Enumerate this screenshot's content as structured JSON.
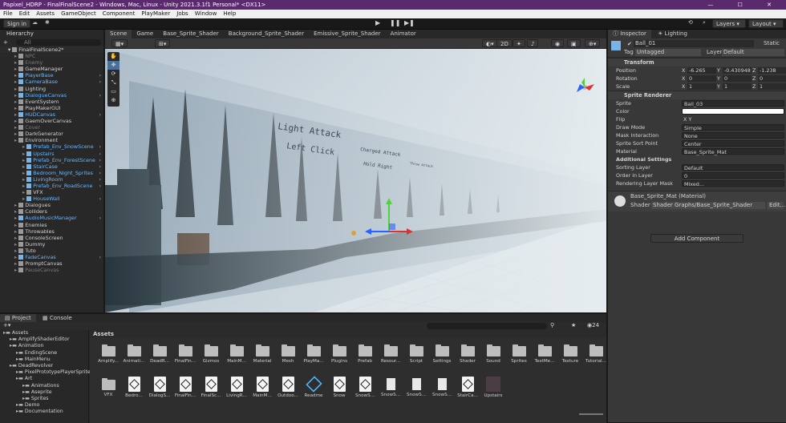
{
  "titlebar": {
    "title": "Papixel_HDRP - FinalFinalScene2 - Windows, Mac, Linux - Unity 2021.3.1f1 Personal* <DX11>",
    "controls": "—  ☐  ✕"
  },
  "menu": [
    "File",
    "Edit",
    "Assets",
    "GameObject",
    "Component",
    "PlayMaker",
    "Jobs",
    "Window",
    "Help"
  ],
  "toolbar": {
    "signin": "Sign in",
    "layers": "Layers",
    "layout": "Layout"
  },
  "hierarchy": {
    "tab": "Hierarchy",
    "add": "+",
    "search": "All",
    "scene": "FinalFinalScene2*",
    "items": [
      {
        "label": "NPC",
        "d": 1,
        "c": "dim"
      },
      {
        "label": "Enemy",
        "d": 1,
        "c": "dim"
      },
      {
        "label": "GameManager",
        "d": 1,
        "c": ""
      },
      {
        "label": "PlayerBase",
        "d": 1,
        "c": "blue"
      },
      {
        "label": "CameraBase",
        "d": 1,
        "c": "blue"
      },
      {
        "label": "Lighting",
        "d": 1,
        "c": ""
      },
      {
        "label": "DialogueCanvas",
        "d": 1,
        "c": "blue"
      },
      {
        "label": "EventSystem",
        "d": 1,
        "c": ""
      },
      {
        "label": "PlayMakerGUI",
        "d": 1,
        "c": ""
      },
      {
        "label": "HUDCanvas",
        "d": 1,
        "c": "blue"
      },
      {
        "label": "GaemOverCanvas",
        "d": 1,
        "c": ""
      },
      {
        "label": "Cover",
        "d": 1,
        "c": "dim"
      },
      {
        "label": "DarkGenerator",
        "d": 1,
        "c": ""
      },
      {
        "label": "Environment",
        "d": 1,
        "c": ""
      },
      {
        "label": "Prefab_Env_SnowScene",
        "d": 2,
        "c": "blue"
      },
      {
        "label": "Upstairs",
        "d": 2,
        "c": "blue"
      },
      {
        "label": "Prefab_Env_ForestScene",
        "d": 2,
        "c": "blue"
      },
      {
        "label": "StairCase",
        "d": 2,
        "c": "blue"
      },
      {
        "label": "Bedroom_Night_Sprites",
        "d": 2,
        "c": "blue"
      },
      {
        "label": "LivingRoom",
        "d": 2,
        "c": "blue"
      },
      {
        "label": "Prefab_Env_RoadScene",
        "d": 2,
        "c": "blue"
      },
      {
        "label": "VFX",
        "d": 2,
        "c": ""
      },
      {
        "label": "HouseWall",
        "d": 2,
        "c": "blue"
      },
      {
        "label": "Dialogues",
        "d": 1,
        "c": ""
      },
      {
        "label": "Colliders",
        "d": 1,
        "c": ""
      },
      {
        "label": "AudioMusicManager",
        "d": 1,
        "c": "blue"
      },
      {
        "label": "Enemies",
        "d": 1,
        "c": ""
      },
      {
        "label": "Throwables",
        "d": 1,
        "c": ""
      },
      {
        "label": "ConsoleScreen",
        "d": 1,
        "c": ""
      },
      {
        "label": "Dummy",
        "d": 1,
        "c": ""
      },
      {
        "label": "Tuto",
        "d": 1,
        "c": ""
      },
      {
        "label": "FadeCanvas",
        "d": 1,
        "c": "blue"
      },
      {
        "label": "PromptCanvas",
        "d": 1,
        "c": ""
      },
      {
        "label": "PauseCanvas",
        "d": 1,
        "c": "dim"
      }
    ]
  },
  "sceneview": {
    "tabs": [
      "Scene",
      "Game",
      "Base_Sprite_Shader",
      "Background_Sprite_Shader",
      "Emissive_Sprite_Shader",
      "Animator"
    ],
    "mode2d": "2D",
    "signs": {
      "light_attack": "Light Attack",
      "left_click": "Left Click",
      "charged": "Charged Attack",
      "hold": "Hold Right",
      "throw": "Throw Attack"
    }
  },
  "inspector": {
    "tabs": [
      "Inspector",
      "Lighting"
    ],
    "object": "Ball_01",
    "static": "Static",
    "tag_label": "Tag",
    "tag": "Untagged",
    "layer_label": "Layer",
    "layer": "Default",
    "transform": {
      "title": "Transform",
      "rows": [
        {
          "label": "Position",
          "x": "-6.265",
          "y": "-0.430948",
          "z": "-1.238"
        },
        {
          "label": "Rotation",
          "x": "0",
          "y": "0",
          "z": "0"
        },
        {
          "label": "Scale",
          "x": "1",
          "y": "1",
          "z": "1"
        }
      ]
    },
    "sprite_renderer": {
      "title": "Sprite Renderer",
      "rows": [
        {
          "label": "Sprite",
          "value": "Ball_03"
        },
        {
          "label": "Color",
          "value": ""
        },
        {
          "label": "Flip",
          "value": "X   Y"
        },
        {
          "label": "Draw Mode",
          "value": "Simple"
        },
        {
          "label": "Mask Interaction",
          "value": "None"
        },
        {
          "label": "Sprite Sort Point",
          "value": "Center"
        },
        {
          "label": "Material",
          "value": "Base_Sprite_Mat"
        }
      ],
      "additional": "Additional Settings",
      "extra": [
        {
          "label": "Sorting Layer",
          "value": "Default"
        },
        {
          "label": "Order in Layer",
          "value": "0"
        },
        {
          "label": "Rendering Layer Mask",
          "value": "Mixed..."
        }
      ]
    },
    "material": {
      "name": "Base_Sprite_Mat (Material)",
      "shader_label": "Shader",
      "shader": "Shader Graphs/Base_Sprite_Shader",
      "edit": "Edit..."
    },
    "add_component": "Add Component"
  },
  "project": {
    "tabs": [
      "Project",
      "Console"
    ],
    "count": "24",
    "tree": [
      {
        "label": "Assets",
        "d": 0
      },
      {
        "label": "AmplifyShaderEditor",
        "d": 1
      },
      {
        "label": "Animation",
        "d": 1
      },
      {
        "label": "EndingScene",
        "d": 2
      },
      {
        "label": "MainMenu",
        "d": 2
      },
      {
        "label": "DeadRevolver",
        "d": 1
      },
      {
        "label": "PixelPrototypePlayerSprite",
        "d": 2
      },
      {
        "label": "Art",
        "d": 2
      },
      {
        "label": "Animations",
        "d": 3
      },
      {
        "label": "Aseprite",
        "d": 3
      },
      {
        "label": "Sprites",
        "d": 3
      },
      {
        "label": "Demo",
        "d": 2
      },
      {
        "label": "Documentation",
        "d": 2
      }
    ],
    "path": "Assets",
    "row1": [
      "Amplify...",
      "Animati...",
      "DeadR...",
      "FinalFin...",
      "Gizmos",
      "MainM...",
      "Material",
      "Mesh",
      "PlayMa...",
      "Plugins",
      "Prefab",
      "Resour...",
      "Script",
      "Settings",
      "Shader",
      "Sound",
      "Sprites",
      "TextMe...",
      "Texture",
      "Tutorial..."
    ],
    "row2": [
      {
        "label": "VFX",
        "t": "folder"
      },
      {
        "label": "Bedro...",
        "t": "unity"
      },
      {
        "label": "DialogS...",
        "t": "unity"
      },
      {
        "label": "FinalFin...",
        "t": "unity"
      },
      {
        "label": "FinalSc...",
        "t": "unity"
      },
      {
        "label": "LivingR...",
        "t": "unity"
      },
      {
        "label": "MainM...",
        "t": "unity"
      },
      {
        "label": "Outdoo...",
        "t": "unity"
      },
      {
        "label": "Readme",
        "t": "readme"
      },
      {
        "label": "Snow",
        "t": "unity"
      },
      {
        "label": "SnowS...",
        "t": "unity"
      },
      {
        "label": "SnowS...",
        "t": "doc"
      },
      {
        "label": "SnowS...",
        "t": "doc"
      },
      {
        "label": "SnowS...",
        "t": "doc"
      },
      {
        "label": "StairCa...",
        "t": "unity"
      },
      {
        "label": "Upstairs",
        "t": "mat"
      }
    ]
  }
}
